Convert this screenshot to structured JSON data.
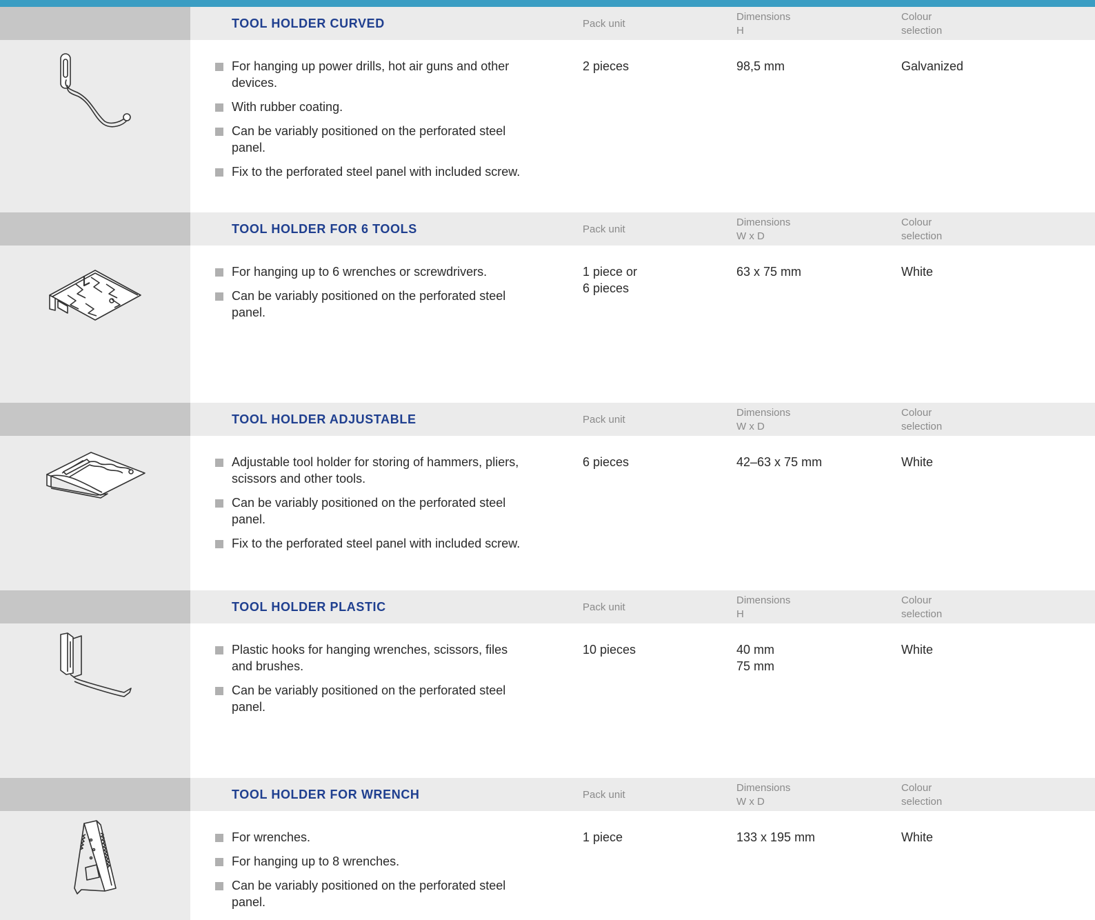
{
  "columns": {
    "pack_unit": "Pack unit",
    "dimensions": "Dimensions",
    "colour_1": "Colour",
    "colour_2": "selection"
  },
  "products": [
    {
      "title": "TOOL HOLDER CURVED",
      "dim_unit": "H",
      "icon": "curved-hook-icon",
      "bullets": [
        "For hanging up power drills, hot air guns and other devices.",
        "With rubber coating.",
        "Can be variably positioned on the perforated steel panel.",
        "Fix to the perforated steel panel with included screw."
      ],
      "pack": [
        "2 pieces"
      ],
      "dims": [
        "98,5 mm"
      ],
      "colour": "Galvanized"
    },
    {
      "title": "TOOL HOLDER FOR 6 TOOLS",
      "dim_unit": "W x D",
      "icon": "six-tool-holder-icon",
      "bullets": [
        "For hanging up to 6 wrenches or screwdrivers.",
        "Can be variably positioned on the perforated steel panel."
      ],
      "pack": [
        "1 piece or",
        "6 pieces"
      ],
      "dims": [
        "63 x 75 mm"
      ],
      "colour": "White"
    },
    {
      "title": "TOOL HOLDER ADJUSTABLE",
      "dim_unit": "W x D",
      "icon": "adjustable-holder-icon",
      "bullets": [
        "Adjustable tool holder for storing of hammers, pliers, scissors and other tools.",
        "Can be variably positioned on the perforated steel panel.",
        "Fix to the perforated steel panel with included screw."
      ],
      "pack": [
        "6 pieces"
      ],
      "dims": [
        "42–63 x 75 mm"
      ],
      "colour": "White"
    },
    {
      "title": "TOOL HOLDER PLASTIC",
      "dim_unit": "H",
      "icon": "plastic-hook-icon",
      "bullets": [
        "Plastic hooks for hanging wrenches, scissors, files and brushes.",
        "Can be variably positioned on the perforated steel panel."
      ],
      "pack": [
        "10 pieces"
      ],
      "dims": [
        "40 mm",
        "75 mm"
      ],
      "colour": "White"
    },
    {
      "title": "TOOL HOLDER FOR WRENCH",
      "dim_unit": "W x D",
      "icon": "wrench-holder-icon",
      "bullets": [
        "For wrenches.",
        "For hanging up to 8 wrenches.",
        "Can be variably positioned on the perforated steel panel."
      ],
      "pack": [
        "1 piece"
      ],
      "dims": [
        "133 x 195 mm"
      ],
      "colour": "White"
    }
  ]
}
